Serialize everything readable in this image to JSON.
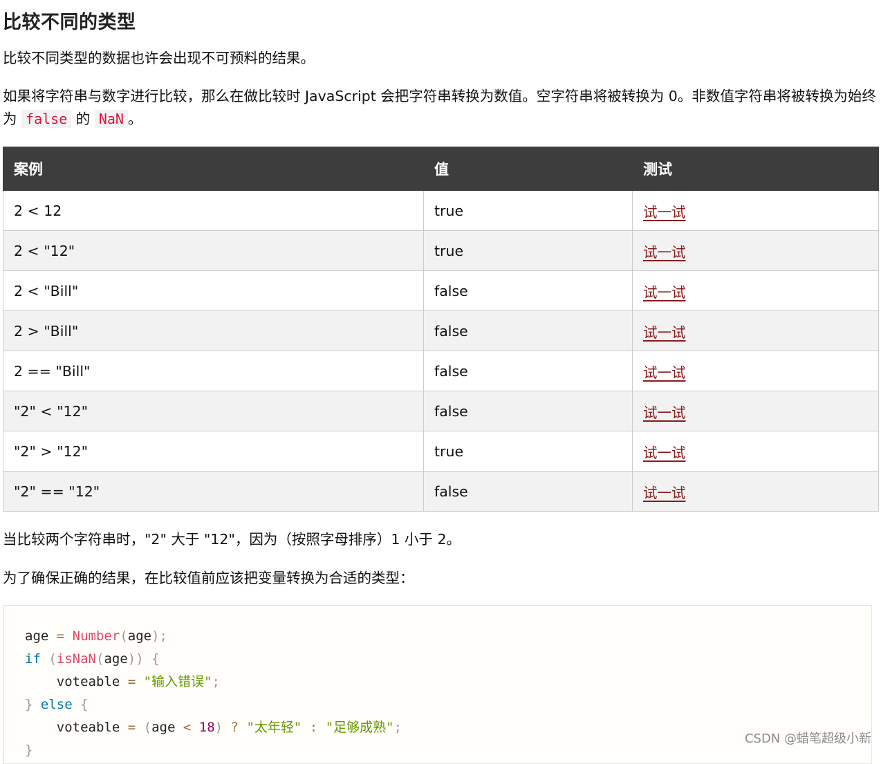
{
  "heading": "比较不同的类型",
  "para1": "比较不同类型的数据也许会出现不可预料的结果。",
  "para2": {
    "text_a": "如果将字符串与数字进行比较，那么在做比较时 JavaScript 会把字符串转换为数值。空字符串将被转换为 0。非数值字符串将被转换为始终为",
    "code_false": "false",
    "text_b": "的",
    "code_nan": "NaN",
    "text_c": "。"
  },
  "table": {
    "headers": [
      "案例",
      "值",
      "测试"
    ],
    "rows": [
      {
        "case": "2 < 12",
        "value": "true",
        "link": "试一试"
      },
      {
        "case": "2 < \"12\"",
        "value": "true",
        "link": "试一试"
      },
      {
        "case": "2 < \"Bill\"",
        "value": "false",
        "link": "试一试"
      },
      {
        "case": "2 > \"Bill\"",
        "value": "false",
        "link": "试一试"
      },
      {
        "case": "2 == \"Bill\"",
        "value": "false",
        "link": "试一试"
      },
      {
        "case": "\"2\" < \"12\"",
        "value": "false",
        "link": "试一试"
      },
      {
        "case": "\"2\" > \"12\"",
        "value": "true",
        "link": "试一试"
      },
      {
        "case": "\"2\" == \"12\"",
        "value": "false",
        "link": "试一试"
      }
    ]
  },
  "para3": "当比较两个字符串时，\"2\" 大于 \"12\"，因为（按照字母排序）1 小于 2。",
  "para4": "为了确保正确的结果，在比较值前应该把变量转换为合适的类型：",
  "code": {
    "str1": "\"输入错误\"",
    "str2": "\"太年轻\"",
    "str3": "\"足够成熟\"",
    "num18": "18"
  },
  "watermark": "CSDN @蜡笔超级小新",
  "colors": {
    "header_bg": "#3d3d3d",
    "link": "#8a1a1a",
    "inline_code": "#dc143c",
    "stripe": "#f2f2f2"
  }
}
